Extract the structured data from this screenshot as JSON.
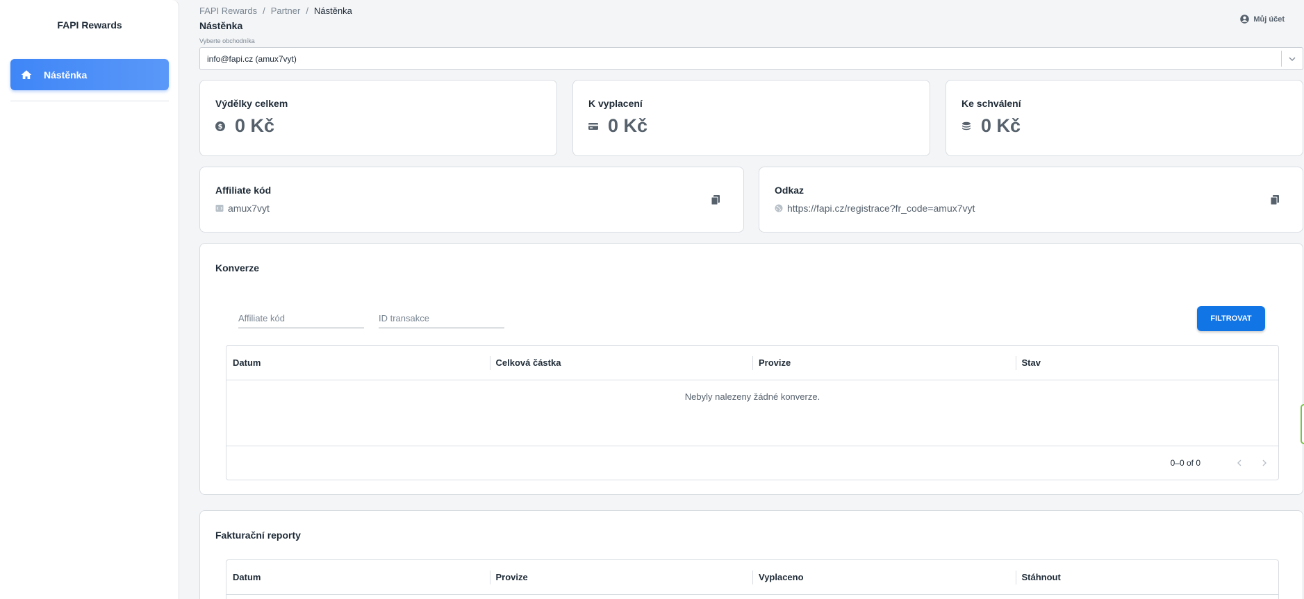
{
  "sidebar": {
    "brand": "FAPI Rewards",
    "items": [
      {
        "label": "Nástěnka",
        "icon": "home-icon",
        "active": true
      }
    ]
  },
  "header": {
    "breadcrumb": [
      "FAPI Rewards",
      "Partner",
      "Nástěnka"
    ],
    "breadcrumb_sep": "/",
    "title": "Nástěnka",
    "account_label": "Můj účet"
  },
  "merchant_select": {
    "label": "Vyberte obchodníka",
    "value": "info@fapi.cz (amux7vyt)"
  },
  "stats": [
    {
      "label": "Výdělky celkem",
      "value": "0 Kč",
      "icon": "dollar-coin-icon"
    },
    {
      "label": "K vyplacení",
      "value": "0 Kč",
      "icon": "credit-card-icon"
    },
    {
      "label": "Ke schválení",
      "value": "0 Kč",
      "icon": "coin-stack-icon"
    }
  ],
  "affiliate": {
    "label": "Affiliate kód",
    "value": "amux7vyt",
    "icon": "code-tag-icon"
  },
  "link": {
    "label": "Odkaz",
    "value": "https://fapi.cz/registrace?fr_code=amux7vyt",
    "icon": "globe-icon"
  },
  "conversions": {
    "title": "Konverze",
    "filter_affiliate_placeholder": "Affiliate kód",
    "filter_transaction_placeholder": "ID transakce",
    "filter_button": "FILTROVAT",
    "columns": [
      "Datum",
      "Celková částka",
      "Provize",
      "Stav"
    ],
    "empty_text": "Nebyly nalezeny žádné konverze.",
    "pagination": "0–0 of 0"
  },
  "invoice_reports": {
    "title": "Fakturační reporty",
    "columns": [
      "Datum",
      "Provize",
      "Vyplaceno",
      "Stáhnout"
    ]
  },
  "colors": {
    "accent": "#3f86f7",
    "button": "#1275e6",
    "text": "#1e2a36",
    "muted": "#56616c"
  }
}
